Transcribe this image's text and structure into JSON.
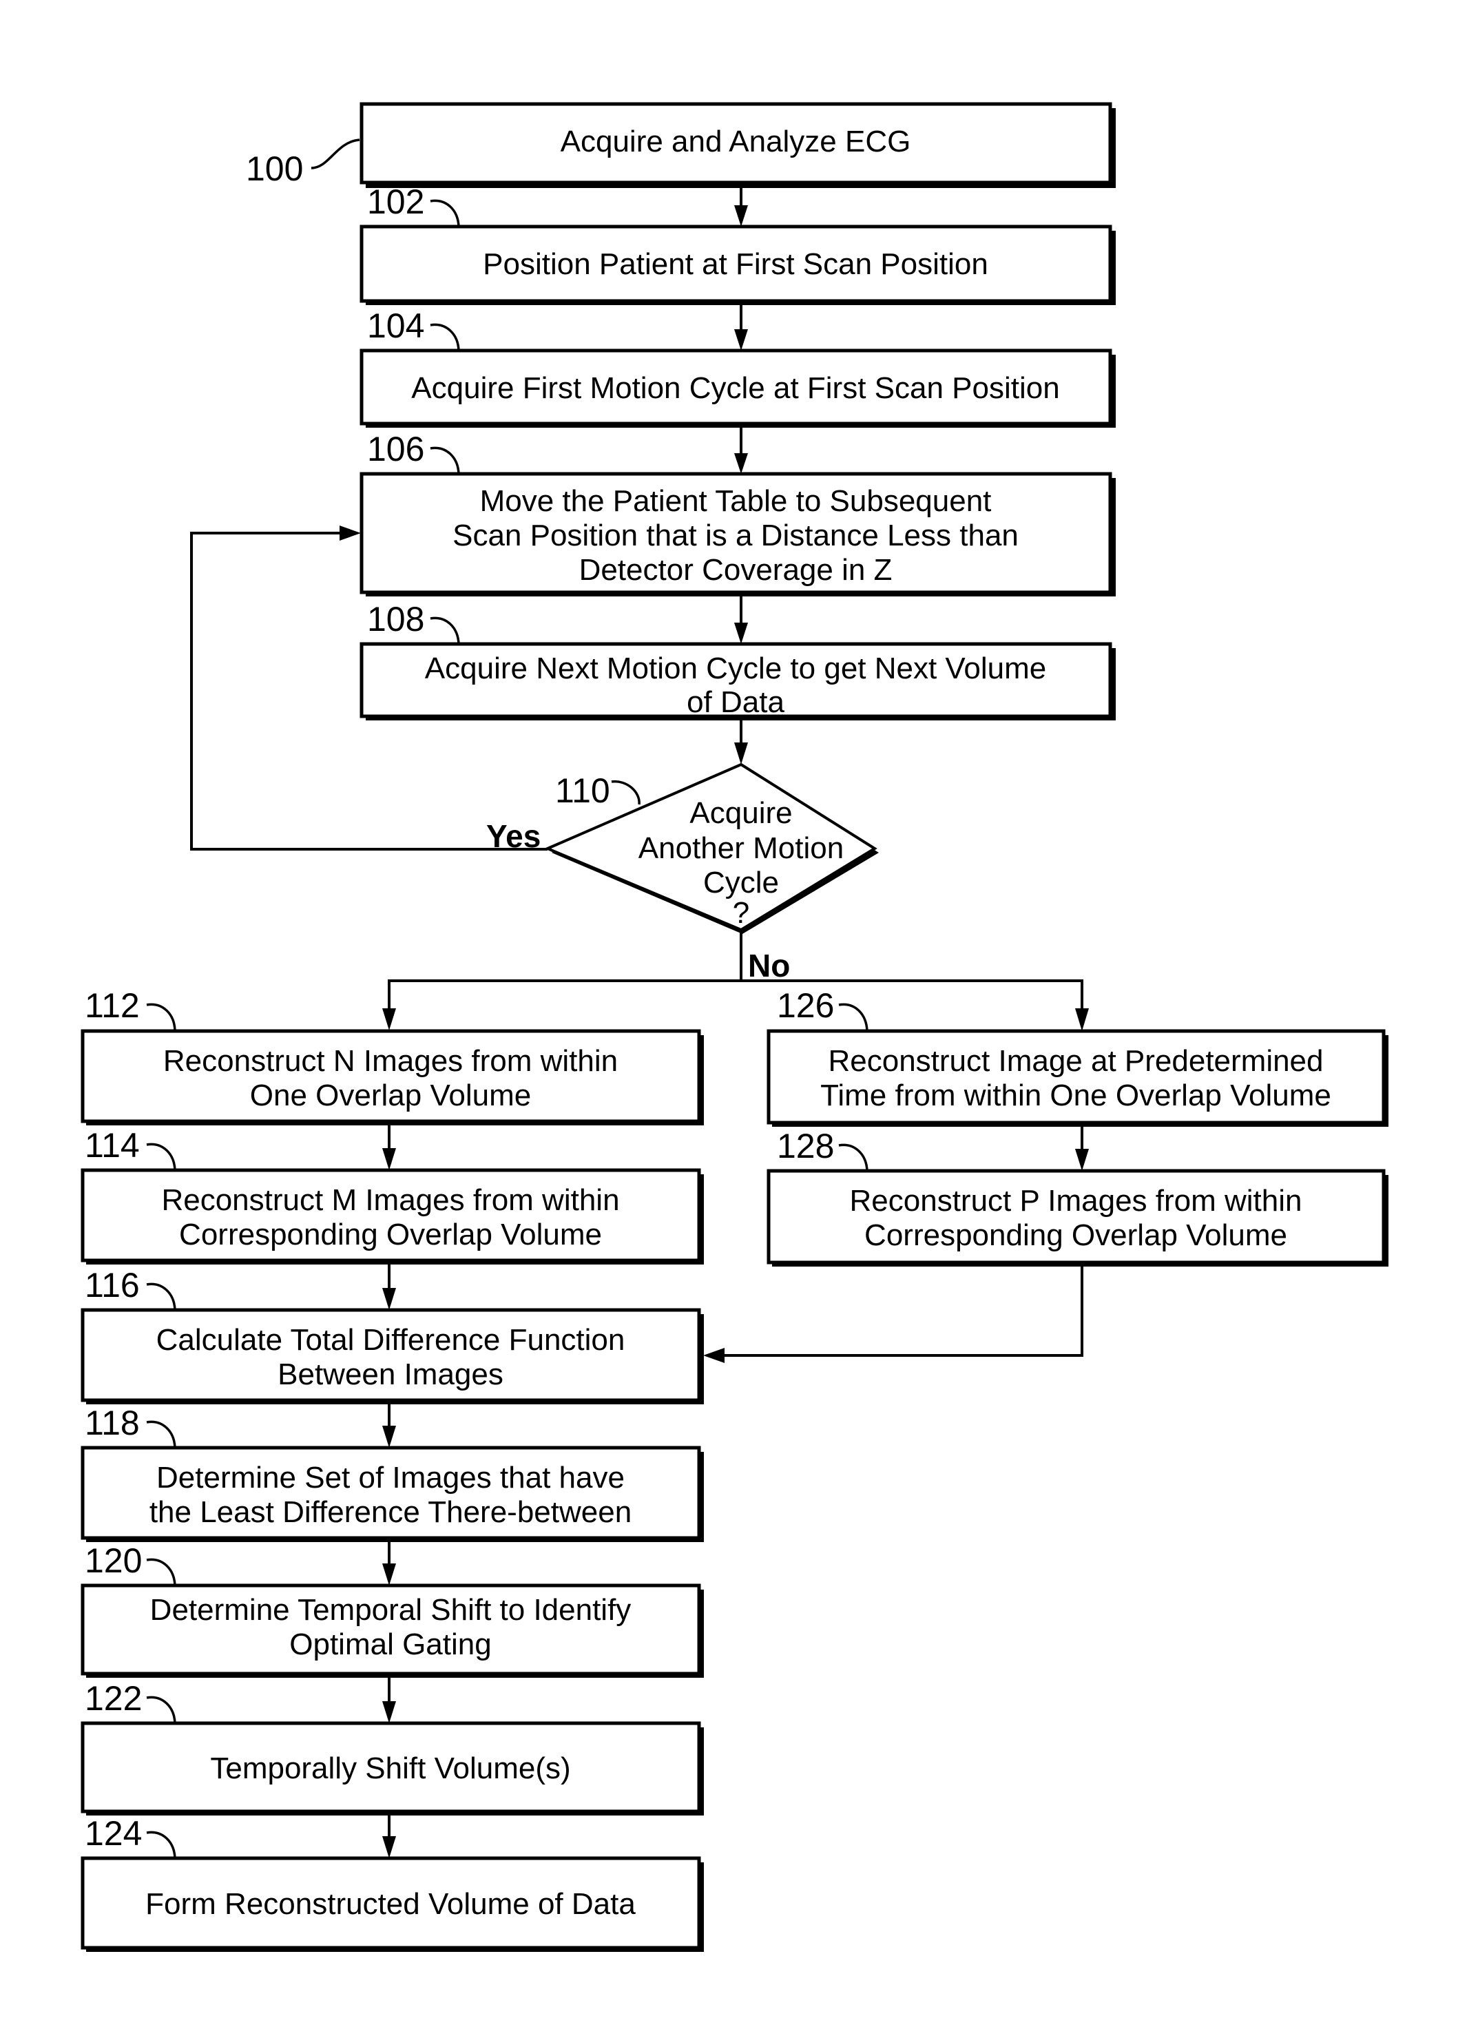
{
  "figure": {
    "type": "flowchart",
    "steps": {
      "s100": {
        "ref": "100",
        "lines": [
          "Acquire and Analyze ECG"
        ]
      },
      "s102": {
        "ref": "102",
        "lines": [
          "Position Patient at First Scan Position"
        ]
      },
      "s104": {
        "ref": "104",
        "lines": [
          "Acquire First Motion Cycle at First Scan Position"
        ]
      },
      "s106": {
        "ref": "106",
        "lines": [
          "Move the Patient Table to Subsequent",
          "Scan Position that is a Distance Less than",
          "Detector Coverage in Z"
        ]
      },
      "s108": {
        "ref": "108",
        "lines": [
          "Acquire Next Motion Cycle to get Next Volume",
          "of Data"
        ]
      },
      "s110": {
        "ref": "110",
        "lines": [
          "Acquire",
          "Another Motion",
          "Cycle",
          "?"
        ]
      },
      "s112": {
        "ref": "112",
        "lines": [
          "Reconstruct N Images from within",
          "One Overlap Volume"
        ]
      },
      "s114": {
        "ref": "114",
        "lines": [
          "Reconstruct M Images from within",
          "Corresponding Overlap Volume"
        ]
      },
      "s116": {
        "ref": "116",
        "lines": [
          "Calculate Total Difference Function",
          "Between Images"
        ]
      },
      "s118": {
        "ref": "118",
        "lines": [
          "Determine Set of Images that have",
          "the Least Difference There-between"
        ]
      },
      "s120": {
        "ref": "120",
        "lines": [
          "Determine Temporal Shift to Identify",
          "Optimal Gating"
        ]
      },
      "s122": {
        "ref": "122",
        "lines": [
          "Temporally Shift Volume(s)"
        ]
      },
      "s124": {
        "ref": "124",
        "lines": [
          "Form Reconstructed Volume of Data"
        ]
      },
      "s126": {
        "ref": "126",
        "lines": [
          "Reconstruct Image at Predetermined",
          "Time from within One Overlap Volume"
        ]
      },
      "s128": {
        "ref": "128",
        "lines": [
          "Reconstruct P Images from within",
          "Corresponding Overlap Volume"
        ]
      }
    },
    "branches": {
      "yes": "Yes",
      "no": "No"
    },
    "edges": [
      [
        "100",
        "102"
      ],
      [
        "102",
        "104"
      ],
      [
        "104",
        "106"
      ],
      [
        "106",
        "108"
      ],
      [
        "108",
        "110"
      ],
      [
        "110",
        "106",
        "Yes"
      ],
      [
        "110",
        "112",
        "No"
      ],
      [
        "110",
        "126",
        "No"
      ],
      [
        "112",
        "114"
      ],
      [
        "114",
        "116"
      ],
      [
        "126",
        "128"
      ],
      [
        "128",
        "116"
      ],
      [
        "116",
        "118"
      ],
      [
        "118",
        "120"
      ],
      [
        "120",
        "122"
      ],
      [
        "122",
        "124"
      ]
    ]
  }
}
